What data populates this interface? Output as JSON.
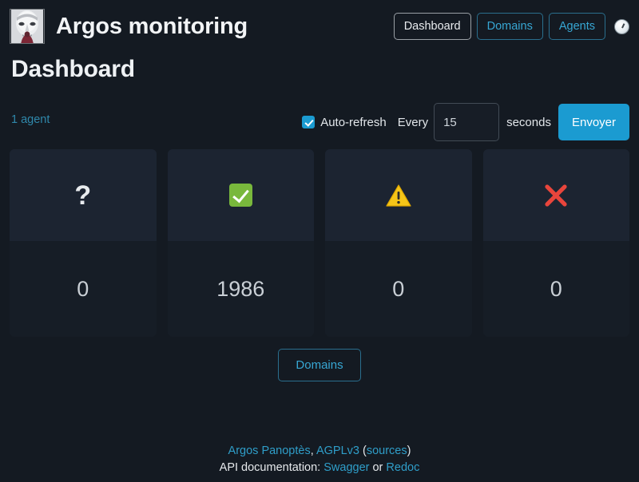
{
  "header": {
    "brand_title": "Argos monitoring",
    "logo_icon": "argos-statue-logo",
    "nav": [
      {
        "label": "Dashboard",
        "state": "active"
      },
      {
        "label": "Domains",
        "state": "link"
      },
      {
        "label": "Agents",
        "state": "link"
      }
    ],
    "theme_toggle_icon": "moon-toggle-icon"
  },
  "page": {
    "title": "Dashboard"
  },
  "controls": {
    "agents_link": "1 agent",
    "auto_refresh_label": "Auto-refresh",
    "auto_refresh_checked": true,
    "every_label": "Every",
    "interval_value": "15",
    "interval_placeholder": "15",
    "seconds_label": "seconds",
    "submit_label": "Envoyer"
  },
  "cards": [
    {
      "icon": "question-mark-icon",
      "status": "unknown",
      "count": "0"
    },
    {
      "icon": "green-check-icon",
      "status": "ok",
      "count": "1986"
    },
    {
      "icon": "warning-triangle-icon",
      "status": "warning",
      "count": "0"
    },
    {
      "icon": "red-cross-icon",
      "status": "critical",
      "count": "0"
    }
  ],
  "domains_button": {
    "label": "Domains"
  },
  "footer": {
    "line1_link1": "Argos Panoptès",
    "line1_comma": ", ",
    "line1_link2": "AGPLv3",
    "line1_open": " (",
    "line1_link3": "sources",
    "line1_close": ")",
    "line2_prefix": "API documentation: ",
    "line2_link1": "Swagger",
    "line2_or": " or ",
    "line2_link2": "Redoc"
  },
  "colors": {
    "page_background": "#141a22",
    "card_header": "#1c2431",
    "card_body": "#161d26",
    "accent_blue": "#1b9bd1",
    "link_blue": "#37a7d4",
    "ok_green": "#79b83c",
    "warning_yellow": "#f5c518",
    "critical_red": "#e8453c",
    "text_primary": "#e9ecef"
  }
}
